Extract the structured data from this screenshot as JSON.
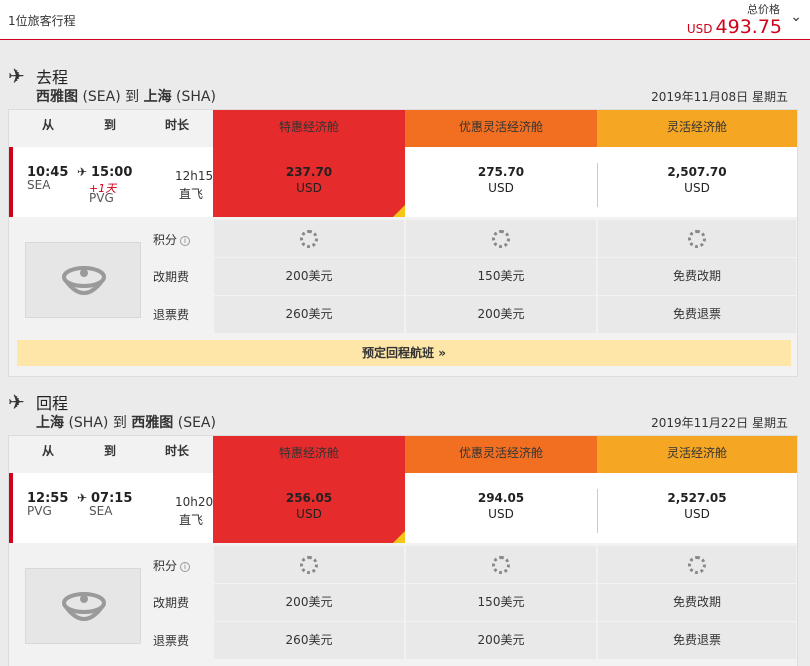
{
  "header": {
    "travelers": "1位旅客行程",
    "total_label": "总价格",
    "currency": "USD",
    "total": "493.75"
  },
  "common": {
    "col_from": "从",
    "col_to": "到",
    "col_duration": "时长",
    "fare_names": [
      "特惠经济舱",
      "优惠灵活经济舱",
      "灵活经济舱"
    ],
    "points_label": "积分",
    "change_label": "改期费",
    "refund_label": "退票费",
    "currency": "USD"
  },
  "outbound": {
    "direction": "去程",
    "from_city": "西雅图",
    "from_code": "(SEA)",
    "to_word": "到",
    "to_city": "上海",
    "to_code": "(SHA)",
    "date": "2019年11月08日 星期五",
    "depart_time": "10:45",
    "arrive_time": "15:00",
    "depart_code": "SEA",
    "arrive_code": "PVG",
    "day_offset": "+1天",
    "duration": "12h15",
    "stops": "直飞",
    "prices": [
      "237.70",
      "275.70",
      "2,507.70"
    ],
    "change_fees": [
      "200美元",
      "150美元",
      "免费改期"
    ],
    "refund_fees": [
      "260美元",
      "200美元",
      "免费退票"
    ],
    "book_return": "预定回程航班"
  },
  "return": {
    "direction": "回程",
    "from_city": "上海",
    "from_code": "(SHA)",
    "to_word": "到",
    "to_city": "西雅图",
    "to_code": "(SEA)",
    "date": "2019年11月22日 星期五",
    "depart_time": "12:55",
    "arrive_time": "07:15",
    "depart_code": "PVG",
    "arrive_code": "SEA",
    "duration": "10h20",
    "stops": "直飞",
    "prices": [
      "256.05",
      "294.05",
      "2,527.05"
    ],
    "change_fees": [
      "200美元",
      "150美元",
      "免费改期"
    ],
    "refund_fees": [
      "260美元",
      "200美元",
      "免费退票"
    ]
  },
  "colors": {
    "red": "#e52b2b",
    "orange": "#f26f21",
    "amber": "#f5a623",
    "book_bar": "#fde6a8"
  },
  "icons": {
    "plane": "airplane-icon",
    "chevron": "chevron-down-icon",
    "info": "info-icon",
    "loading": "loading-spinner-icon",
    "double_chevron": "double-chevron-down-icon",
    "logo": "airline-logo"
  }
}
